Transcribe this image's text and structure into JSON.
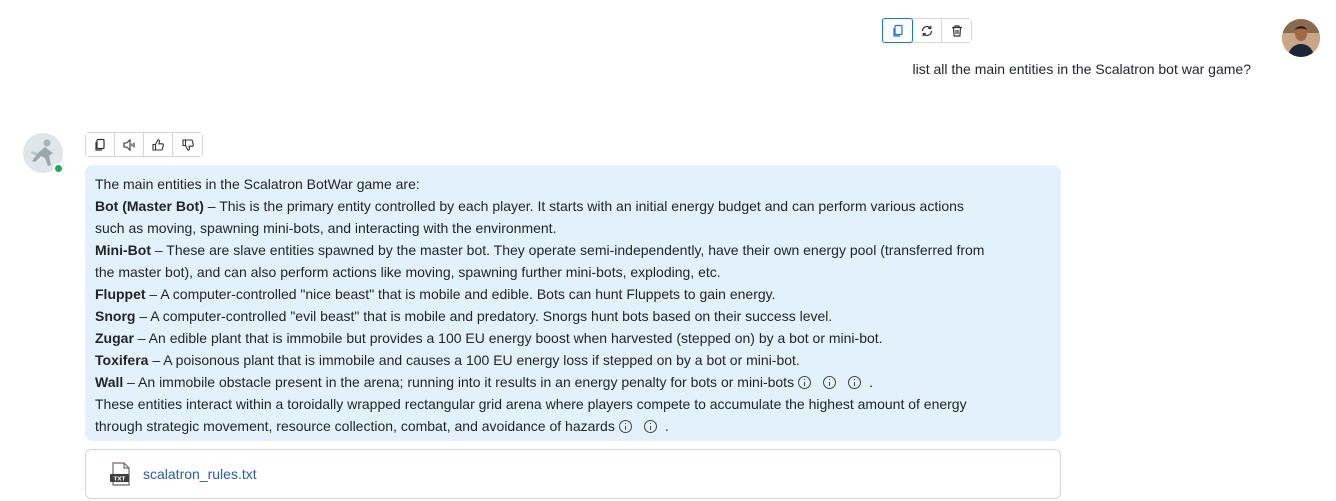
{
  "user_message": {
    "text": "list all the main entities in the Scalatron bot war game?",
    "actions": [
      "copy-icon",
      "regenerate-icon",
      "delete-icon"
    ]
  },
  "assistant_message": {
    "actions": [
      "copy-icon",
      "speaker-icon",
      "thumbs-up-icon",
      "thumbs-down-icon"
    ],
    "intro": "The main entities in the Scalatron BotWar game are:",
    "entities": [
      {
        "name": "Bot (Master Bot)",
        "line1": " – This is the primary entity controlled by each player. It starts with an initial energy budget and can perform various actions",
        "line2": "such as moving, spawning mini-bots, and interacting with the environment."
      },
      {
        "name": "Mini-Bot",
        "line1": " – These are slave entities spawned by the master bot. They operate semi-independently, have their own energy pool (transferred from",
        "line2": "the master bot), and can also perform actions like moving, spawning further mini-bots, exploding, etc."
      },
      {
        "name": "Fluppet",
        "line1": " – A computer-controlled \"nice beast\" that is mobile and edible. Bots can hunt Fluppets to gain energy."
      },
      {
        "name": "Snorg",
        "line1": " – A computer-controlled \"evil beast\" that is mobile and predatory. Snorgs hunt bots based on their success level."
      },
      {
        "name": "Zugar",
        "line1": " – An edible plant that is immobile but provides a 100 EU energy boost when harvested (stepped on) by a bot or mini-bot."
      },
      {
        "name": "Toxifera",
        "line1": " – A poisonous plant that is immobile and causes a 100 EU energy loss if stepped on by a bot or mini-bot."
      },
      {
        "name": "Wall",
        "line1": " – An immobile obstacle present in the arena; running into it results in an energy penalty for bots or mini-bots"
      }
    ],
    "summary_line1": "These entities interact within a toroidally wrapped rectangular grid arena where players compete to accumulate the highest amount of energy",
    "summary_line2": "through strategic movement, resource collection, combat, and avoidance of hazards",
    "period": "."
  },
  "attachment": {
    "file_name": "scalatron_rules.txt",
    "icon": "txt-file-icon",
    "icon_label": "TXT"
  },
  "colors": {
    "bubble_bg": "#e3f1fc",
    "link": "#2a5ba8",
    "online": "#1fa855",
    "active_outline": "#1a73e8"
  }
}
